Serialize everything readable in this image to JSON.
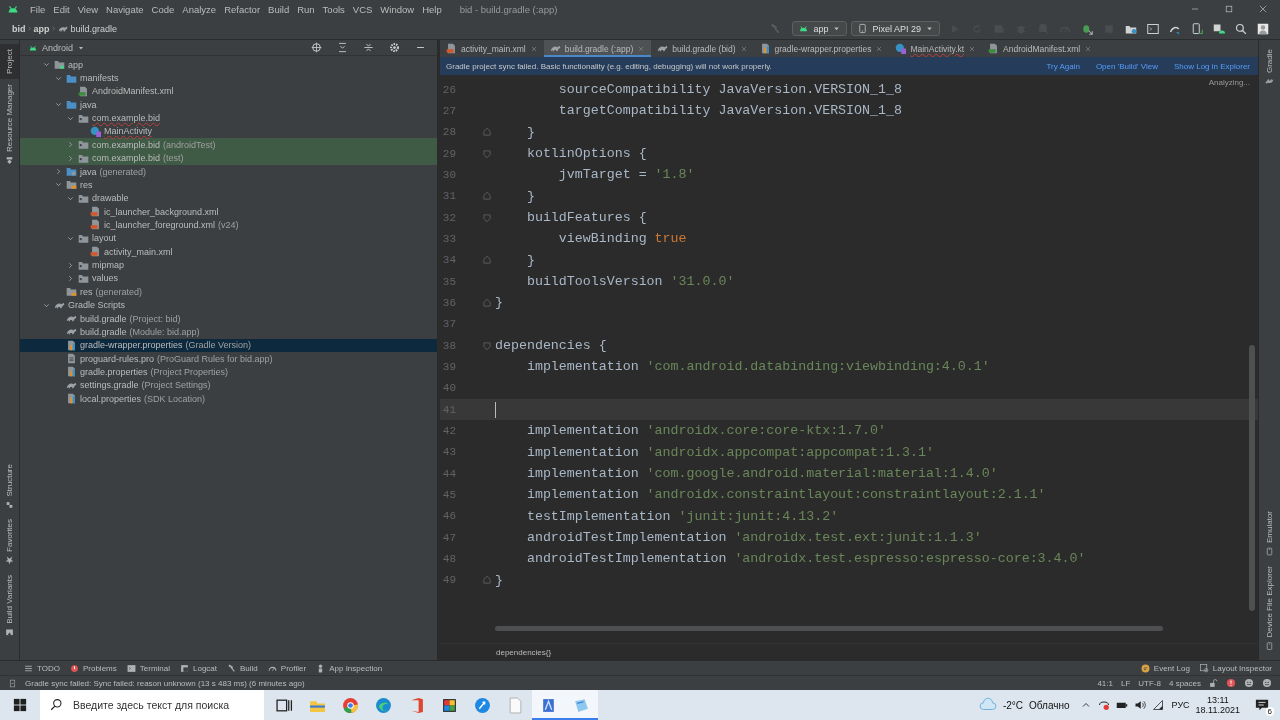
{
  "menu_bar": {
    "items": [
      "File",
      "Edit",
      "View",
      "Navigate",
      "Code",
      "Analyze",
      "Refactor",
      "Build",
      "Run",
      "Tools",
      "VCS",
      "Window",
      "Help"
    ],
    "title": "bid - build.gradle (:app)"
  },
  "navigation_bar": {
    "breadcrumbs": [
      "bid",
      "app",
      "build.gradle"
    ],
    "run_config": "app",
    "device": "Pixel API 29",
    "toolbar": [
      {
        "kind": "play",
        "disabled": true
      },
      {
        "kind": "rerun",
        "disabled": true
      },
      {
        "kind": "apply",
        "disabled": true
      },
      {
        "kind": "bug",
        "disabled": true
      },
      {
        "kind": "attach",
        "disabled": true
      },
      {
        "kind": "gauge",
        "disabled": true
      },
      {
        "kind": "bug-arrow",
        "disabled": false
      },
      {
        "kind": "stop",
        "disabled": true
      },
      {
        "kind": "folder-sync",
        "disabled": false
      },
      {
        "kind": "terminal-box",
        "disabled": false
      },
      {
        "kind": "sync",
        "disabled": false
      },
      {
        "kind": "phone-arrow",
        "disabled": false
      },
      {
        "kind": "android-box",
        "disabled": false
      },
      {
        "kind": "search",
        "disabled": false
      },
      {
        "kind": "avatar",
        "disabled": false
      }
    ]
  },
  "left_strip": {
    "top": [
      {
        "label": "Project",
        "selected": true
      },
      {
        "label": "Resource Manager",
        "selected": false
      }
    ],
    "bottom": [
      {
        "label": "Structure",
        "selected": false
      },
      {
        "label": "Favorites",
        "selected": false
      },
      {
        "label": "Build Variants",
        "selected": false
      }
    ]
  },
  "project": {
    "view": "Android",
    "tree": [
      {
        "label": "app",
        "kind": "module",
        "expanded": true,
        "selected": false,
        "highlighted": false,
        "error": false,
        "children": [
          {
            "label": "manifests",
            "kind": "folder",
            "expanded": true,
            "selected": false,
            "highlighted": false,
            "error": false,
            "children": [
              {
                "label": "AndroidManifest.xml",
                "kind": "manifest",
                "selected": false,
                "highlighted": false,
                "error": false
              }
            ]
          },
          {
            "label": "java",
            "kind": "folder",
            "expanded": true,
            "selected": false,
            "highlighted": false,
            "error": false,
            "children": [
              {
                "label": "com.example.bid",
                "kind": "package",
                "expanded": true,
                "selected": false,
                "highlighted": false,
                "error": true,
                "children": [
                  {
                    "label": "MainActivity",
                    "kind": "kotlin",
                    "selected": false,
                    "highlighted": false,
                    "error": true
                  }
                ]
              },
              {
                "label": "com.example.bid",
                "hint": "(androidTest)",
                "kind": "package",
                "expanded": false,
                "selected": false,
                "highlighted": true,
                "error": false
              },
              {
                "label": "com.example.bid",
                "hint": "(test)",
                "kind": "package",
                "expanded": false,
                "selected": false,
                "highlighted": true,
                "error": false
              }
            ]
          },
          {
            "label": "java",
            "hint": "(generated)",
            "kind": "gen-folder",
            "expanded": false,
            "selected": false,
            "highlighted": false,
            "error": false
          },
          {
            "label": "res",
            "kind": "res-folder",
            "expanded": true,
            "selected": false,
            "highlighted": false,
            "error": false,
            "children": [
              {
                "label": "drawable",
                "kind": "package",
                "expanded": true,
                "selected": false,
                "highlighted": false,
                "error": false,
                "children": [
                  {
                    "label": "ic_launcher_background.xml",
                    "kind": "xml",
                    "selected": false,
                    "highlighted": false,
                    "error": false
                  },
                  {
                    "label": "ic_launcher_foreground.xml",
                    "hint": "(v24)",
                    "kind": "xml",
                    "selected": false,
                    "highlighted": false,
                    "error": false
                  }
                ]
              },
              {
                "label": "layout",
                "kind": "package",
                "expanded": true,
                "selected": false,
                "highlighted": false,
                "error": false,
                "children": [
                  {
                    "label": "activity_main.xml",
                    "kind": "xml",
                    "selected": false,
                    "highlighted": false,
                    "error": false
                  }
                ]
              },
              {
                "label": "mipmap",
                "kind": "package",
                "expanded": false,
                "selected": false,
                "highlighted": false,
                "error": false
              },
              {
                "label": "values",
                "kind": "package",
                "expanded": false,
                "selected": false,
                "highlighted": false,
                "error": false
              }
            ]
          },
          {
            "label": "res",
            "hint": "(generated)",
            "kind": "res-folder",
            "selected": false,
            "highlighted": false,
            "error": false
          }
        ]
      },
      {
        "label": "Gradle Scripts",
        "kind": "gradle",
        "expanded": true,
        "selected": false,
        "highlighted": false,
        "error": false,
        "children": [
          {
            "label": "build.gradle",
            "hint": "(Project: bid)",
            "kind": "gradle",
            "selected": false,
            "highlighted": false,
            "error": false
          },
          {
            "label": "build.gradle",
            "hint": "(Module: bid.app)",
            "kind": "gradle",
            "selected": false,
            "highlighted": false,
            "error": false
          },
          {
            "label": "gradle-wrapper.properties",
            "hint": "(Gradle Version)",
            "kind": "properties",
            "selected": true,
            "highlighted": false,
            "error": false
          },
          {
            "label": "proguard-rules.pro",
            "hint": "(ProGuard Rules for bid.app)",
            "kind": "text",
            "selected": false,
            "highlighted": false,
            "error": false
          },
          {
            "label": "gradle.properties",
            "hint": "(Project Properties)",
            "kind": "properties",
            "selected": false,
            "highlighted": false,
            "error": false
          },
          {
            "label": "settings.gradle",
            "hint": "(Project Settings)",
            "kind": "gradle",
            "selected": false,
            "highlighted": false,
            "error": false
          },
          {
            "label": "local.properties",
            "hint": "(SDK Location)",
            "kind": "properties",
            "selected": false,
            "highlighted": false,
            "error": false
          }
        ]
      }
    ]
  },
  "editor": {
    "tabs": [
      {
        "label": "activity_main.xml",
        "kind": "xml",
        "selected": false,
        "error": false
      },
      {
        "label": "build.gradle (:app)",
        "kind": "gradle",
        "selected": true,
        "error": false
      },
      {
        "label": "build.gradle (bid)",
        "kind": "gradle",
        "selected": false,
        "error": false
      },
      {
        "label": "gradle-wrapper.properties",
        "kind": "properties",
        "selected": false,
        "error": false
      },
      {
        "label": "MainActivity.kt",
        "kind": "kotlin",
        "selected": false,
        "error": true
      },
      {
        "label": "AndroidManifest.xml",
        "kind": "manifest",
        "selected": false,
        "error": false
      }
    ],
    "banner": {
      "message": "Gradle project sync failed. Basic functionality (e.g. editing, debugging) will not work properly.",
      "actions": [
        "Try Again",
        "Open 'Build' View",
        "Show Log in Explorer"
      ]
    },
    "status": "Analyzing...",
    "lines": [
      {
        "number": "26",
        "current": false,
        "fold_open": false,
        "fold_close": false,
        "tokens": [
          {
            "text": "        sourceCompatibility JavaVersion.VERSION_1_8",
            "kind": "plain"
          }
        ]
      },
      {
        "number": "27",
        "current": false,
        "fold_open": false,
        "fold_close": false,
        "tokens": [
          {
            "text": "        targetCompatibility JavaVersion.VERSION_1_8",
            "kind": "plain"
          }
        ]
      },
      {
        "number": "28",
        "current": false,
        "fold_open": false,
        "fold_close": true,
        "tokens": [
          {
            "text": "    }",
            "kind": "plain"
          }
        ]
      },
      {
        "number": "29",
        "current": false,
        "fold_open": true,
        "fold_close": false,
        "tokens": [
          {
            "text": "    kotlinOptions {",
            "kind": "plain"
          }
        ]
      },
      {
        "number": "30",
        "current": false,
        "fold_open": false,
        "fold_close": false,
        "tokens": [
          {
            "text": "        jvmTarget = ",
            "kind": "plain"
          },
          {
            "text": "'1.8'",
            "kind": "string"
          }
        ]
      },
      {
        "number": "31",
        "current": false,
        "fold_open": false,
        "fold_close": true,
        "tokens": [
          {
            "text": "    }",
            "kind": "plain"
          }
        ]
      },
      {
        "number": "32",
        "current": false,
        "fold_open": true,
        "fold_close": false,
        "tokens": [
          {
            "text": "    buildFeatures {",
            "kind": "plain"
          }
        ]
      },
      {
        "number": "33",
        "current": false,
        "fold_open": false,
        "fold_close": false,
        "tokens": [
          {
            "text": "        viewBinding ",
            "kind": "plain"
          },
          {
            "text": "true",
            "kind": "keyword"
          }
        ]
      },
      {
        "number": "34",
        "current": false,
        "fold_open": false,
        "fold_close": true,
        "tokens": [
          {
            "text": "    }",
            "kind": "plain"
          }
        ]
      },
      {
        "number": "35",
        "current": false,
        "fold_open": false,
        "fold_close": false,
        "tokens": [
          {
            "text": "    buildToolsVersion ",
            "kind": "plain"
          },
          {
            "text": "'31.0.0'",
            "kind": "string"
          }
        ]
      },
      {
        "number": "36",
        "current": false,
        "fold_open": false,
        "fold_close": true,
        "tokens": [
          {
            "text": "}",
            "kind": "plain"
          }
        ]
      },
      {
        "number": "37",
        "current": false,
        "fold_open": false,
        "fold_close": false
      },
      {
        "number": "38",
        "current": false,
        "fold_open": true,
        "fold_close": false,
        "tokens": [
          {
            "text": "dependencies {",
            "kind": "plain"
          }
        ]
      },
      {
        "number": "39",
        "current": false,
        "fold_open": false,
        "fold_close": false,
        "tokens": [
          {
            "text": "    implementation ",
            "kind": "plain"
          },
          {
            "text": "'com.android.databinding:viewbinding:4.0.1'",
            "kind": "string"
          }
        ]
      },
      {
        "number": "40",
        "current": false,
        "fold_open": false,
        "fold_close": false
      },
      {
        "number": "41",
        "current": true,
        "fold_open": false,
        "fold_close": false
      },
      {
        "number": "42",
        "current": false,
        "fold_open": false,
        "fold_close": false,
        "tokens": [
          {
            "text": "    implementation ",
            "kind": "plain"
          },
          {
            "text": "'androidx.core:core-ktx:1.7.0'",
            "kind": "string"
          }
        ]
      },
      {
        "number": "43",
        "current": false,
        "fold_open": false,
        "fold_close": false,
        "tokens": [
          {
            "text": "    implementation ",
            "kind": "plain"
          },
          {
            "text": "'androidx.appcompat:appcompat:1.3.1'",
            "kind": "string"
          }
        ]
      },
      {
        "number": "44",
        "current": false,
        "fold_open": false,
        "fold_close": false,
        "tokens": [
          {
            "text": "    implementation ",
            "kind": "plain"
          },
          {
            "text": "'com.google.android.material:material:1.4.0'",
            "kind": "string"
          }
        ]
      },
      {
        "number": "45",
        "current": false,
        "fold_open": false,
        "fold_close": false,
        "tokens": [
          {
            "text": "    implementation ",
            "kind": "plain"
          },
          {
            "text": "'androidx.constraintlayout:constraintlayout:2.1.1'",
            "kind": "string"
          }
        ]
      },
      {
        "number": "46",
        "current": false,
        "fold_open": false,
        "fold_close": false,
        "tokens": [
          {
            "text": "    testImplementation ",
            "kind": "plain"
          },
          {
            "text": "'junit:junit:4.13.2'",
            "kind": "string"
          }
        ]
      },
      {
        "number": "47",
        "current": false,
        "fold_open": false,
        "fold_close": false,
        "tokens": [
          {
            "text": "    androidTestImplementation ",
            "kind": "plain"
          },
          {
            "text": "'androidx.test.ext:junit:1.1.3'",
            "kind": "string"
          }
        ]
      },
      {
        "number": "48",
        "current": false,
        "fold_open": false,
        "fold_close": false,
        "tokens": [
          {
            "text": "    androidTestImplementation ",
            "kind": "plain"
          },
          {
            "text": "'androidx.test.espresso:espresso-core:3.4.0'",
            "kind": "string"
          }
        ]
      },
      {
        "number": "49",
        "current": false,
        "fold_open": false,
        "fold_close": true,
        "tokens": [
          {
            "text": "}",
            "kind": "plain"
          }
        ]
      }
    ],
    "breadcrumb": "dependencies{}"
  },
  "right_strip": {
    "top": [
      {
        "label": "Gradle",
        "selected": false
      }
    ],
    "bottom": [
      {
        "label": "Emulator",
        "selected": false
      },
      {
        "label": "Device File Explorer",
        "selected": false
      }
    ]
  },
  "tool_windows": {
    "left": [
      {
        "label": "TODO",
        "kind": "list"
      },
      {
        "label": "Problems",
        "kind": "problems"
      },
      {
        "label": "Terminal",
        "kind": "terminal"
      },
      {
        "label": "Logcat",
        "kind": "logcat"
      },
      {
        "label": "Build",
        "kind": "hammer"
      },
      {
        "label": "Profiler",
        "kind": "gauge"
      },
      {
        "label": "App Inspection",
        "kind": "inspection"
      }
    ],
    "right": [
      {
        "label": "Event Log",
        "kind": "event-log"
      },
      {
        "label": "Layout Inspector",
        "kind": "layout-inspector"
      }
    ]
  },
  "status_bar": {
    "message": "Gradle sync failed: Sync failed: reason unknown (13 s 483 ms) (6 minutes ago)",
    "items": [
      "41:1",
      "LF",
      "UTF-8",
      "4 spaces"
    ]
  },
  "taskbar": {
    "search_placeholder": "Введите здесь текст для поиска",
    "apps": [
      {
        "kind": "task-view",
        "active": false
      },
      {
        "kind": "explorer",
        "active": false
      },
      {
        "kind": "chrome",
        "active": false
      },
      {
        "kind": "edge",
        "active": false
      },
      {
        "kind": "office",
        "active": false
      },
      {
        "kind": "cube",
        "active": false
      },
      {
        "kind": "share",
        "active": false
      },
      {
        "kind": "doc",
        "active": false
      },
      {
        "kind": "studio",
        "active": true
      },
      {
        "kind": "notepad",
        "active": true
      }
    ],
    "temperature": "-2°C",
    "weather": "Облачно",
    "language": "РУС",
    "time": "13:11",
    "date": "18.11.2021",
    "notifications": "6"
  }
}
